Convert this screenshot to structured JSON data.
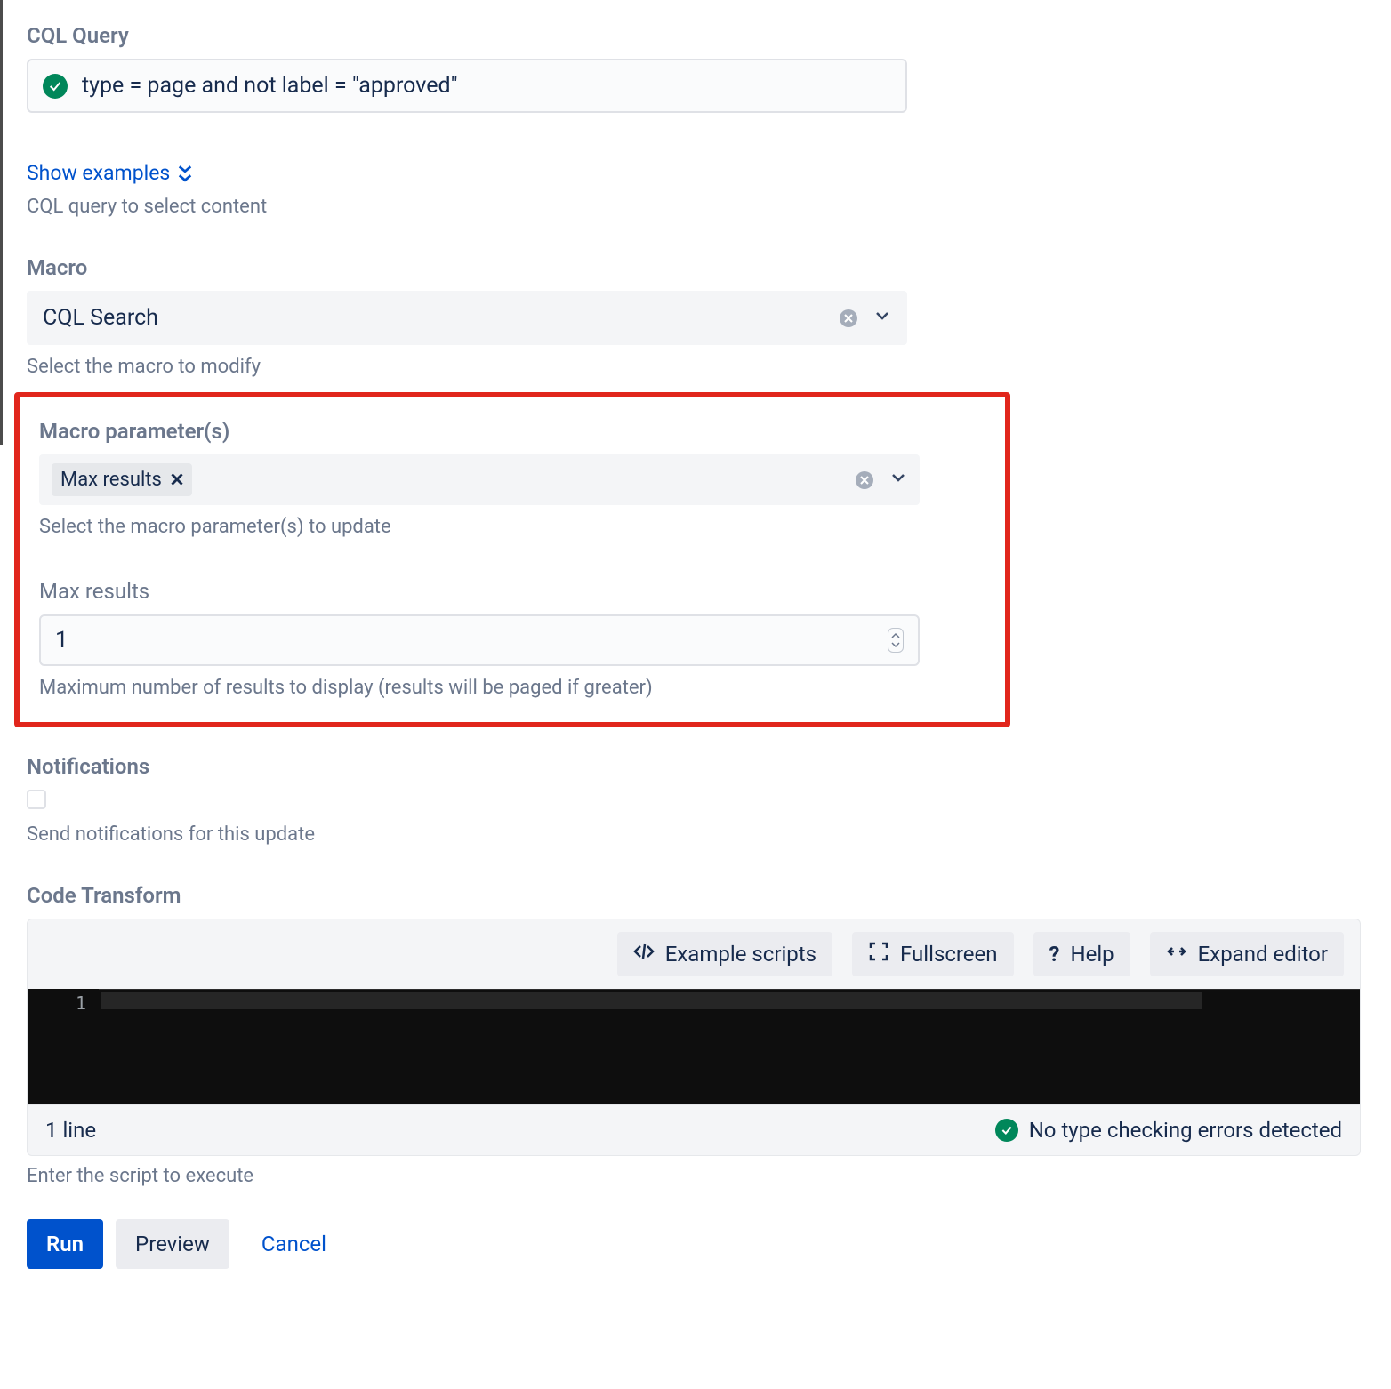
{
  "cql": {
    "label": "CQL Query",
    "value": "type = page and not label = \"approved\"",
    "show_examples": "Show examples",
    "helper": "CQL query to select content"
  },
  "macro": {
    "label": "Macro",
    "value": "CQL Search",
    "helper": "Select the macro to modify"
  },
  "params": {
    "label": "Macro parameter(s)",
    "chip": "Max results",
    "helper": "Select the macro parameter(s) to update"
  },
  "max_results": {
    "label": "Max results",
    "value": "1",
    "helper": "Maximum number of results to display (results will be paged if greater)"
  },
  "notifications": {
    "label": "Notifications",
    "helper": "Send notifications for this update"
  },
  "code": {
    "label": "Code Transform",
    "toolbar": {
      "examples": "Example scripts",
      "fullscreen": "Fullscreen",
      "help": "Help",
      "expand": "Expand editor"
    },
    "line_number": "1",
    "status_left": "1 line",
    "status_right": "No type checking errors detected",
    "helper": "Enter the script to execute"
  },
  "actions": {
    "run": "Run",
    "preview": "Preview",
    "cancel": "Cancel"
  }
}
